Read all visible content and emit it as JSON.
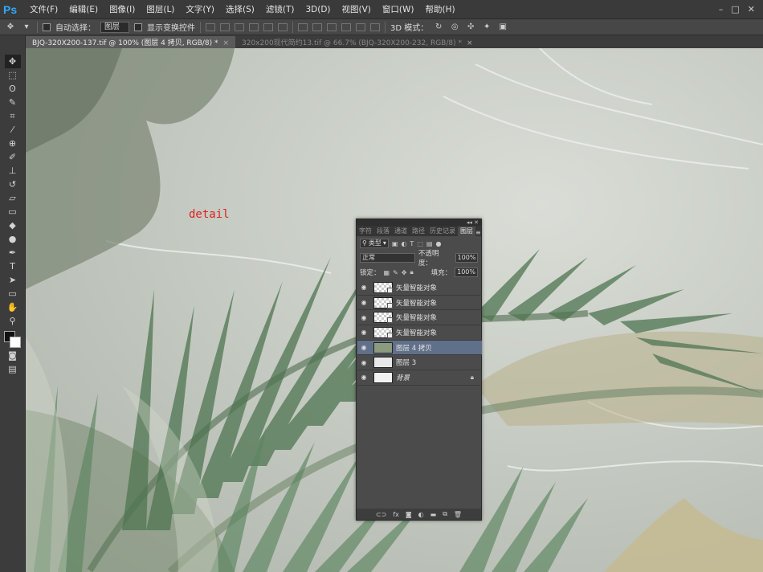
{
  "menubar": {
    "logo": "Ps",
    "items": [
      "文件(F)",
      "编辑(E)",
      "图像(I)",
      "图层(L)",
      "文字(Y)",
      "选择(S)",
      "滤镜(T)",
      "3D(D)",
      "视图(V)",
      "窗口(W)",
      "帮助(H)"
    ],
    "window_controls": [
      "–",
      "□",
      "✕"
    ]
  },
  "options": {
    "auto_select_label": "自动选择：",
    "auto_select_value": "图层",
    "show_transform_label": "显示变换控件",
    "mode_3d_label": "3D 模式："
  },
  "tabs": [
    {
      "label": "BJQ-320X200-137.tif @ 100% (图层 4 拷贝, RGB/8) *",
      "close": "×"
    },
    {
      "label": "320x200现代简约13.tif @ 66.7% (BJQ-320X200-232, RGB/8) *",
      "close": "×"
    }
  ],
  "tools": [
    {
      "name": "move-tool",
      "glyph": "✥"
    },
    {
      "name": "marquee-tool",
      "glyph": "⬚"
    },
    {
      "name": "lasso-tool",
      "glyph": "ʘ"
    },
    {
      "name": "quick-select-tool",
      "glyph": "✎"
    },
    {
      "name": "crop-tool",
      "glyph": "⌗"
    },
    {
      "name": "eyedropper-tool",
      "glyph": "⁄"
    },
    {
      "name": "healing-tool",
      "glyph": "⊕"
    },
    {
      "name": "brush-tool",
      "glyph": "✐"
    },
    {
      "name": "stamp-tool",
      "glyph": "⊥"
    },
    {
      "name": "history-brush-tool",
      "glyph": "↺"
    },
    {
      "name": "eraser-tool",
      "glyph": "▱"
    },
    {
      "name": "gradient-tool",
      "glyph": "▭"
    },
    {
      "name": "blur-tool",
      "glyph": "◆"
    },
    {
      "name": "dodge-tool",
      "glyph": "●"
    },
    {
      "name": "pen-tool",
      "glyph": "✒"
    },
    {
      "name": "type-tool",
      "glyph": "T"
    },
    {
      "name": "path-select-tool",
      "glyph": "➤"
    },
    {
      "name": "shape-tool",
      "glyph": "▭"
    },
    {
      "name": "hand-tool",
      "glyph": "✋"
    },
    {
      "name": "zoom-tool",
      "glyph": "⚲"
    }
  ],
  "canvas": {
    "annotation": "detail"
  },
  "layers_panel": {
    "tabs": [
      "字符",
      "段落",
      "通道",
      "路径",
      "历史记录",
      "图层"
    ],
    "filter_kind": "类型",
    "blend_mode": "正常",
    "opacity_label": "不透明度：",
    "opacity_value": "100%",
    "lock_label": "锁定：",
    "fill_label": "填充：",
    "fill_value": "100%",
    "layers": [
      {
        "name": "矢量智能对象",
        "thumb": "smart",
        "selected": false
      },
      {
        "name": "矢量智能对象",
        "thumb": "smart",
        "selected": false
      },
      {
        "name": "矢量智能对象",
        "thumb": "smart",
        "selected": false
      },
      {
        "name": "矢量智能对象",
        "thumb": "smart",
        "selected": false
      },
      {
        "name": "图层 4 拷贝",
        "thumb": "img",
        "selected": true
      },
      {
        "name": "图层 3",
        "thumb": "plain2",
        "selected": false
      },
      {
        "name": "背景",
        "thumb": "plain",
        "selected": false,
        "locked": true
      }
    ],
    "footer_icons": [
      "link-icon",
      "fx-icon",
      "mask-icon",
      "adjustment-icon",
      "folder-icon",
      "new-layer-icon",
      "trash-icon"
    ]
  }
}
